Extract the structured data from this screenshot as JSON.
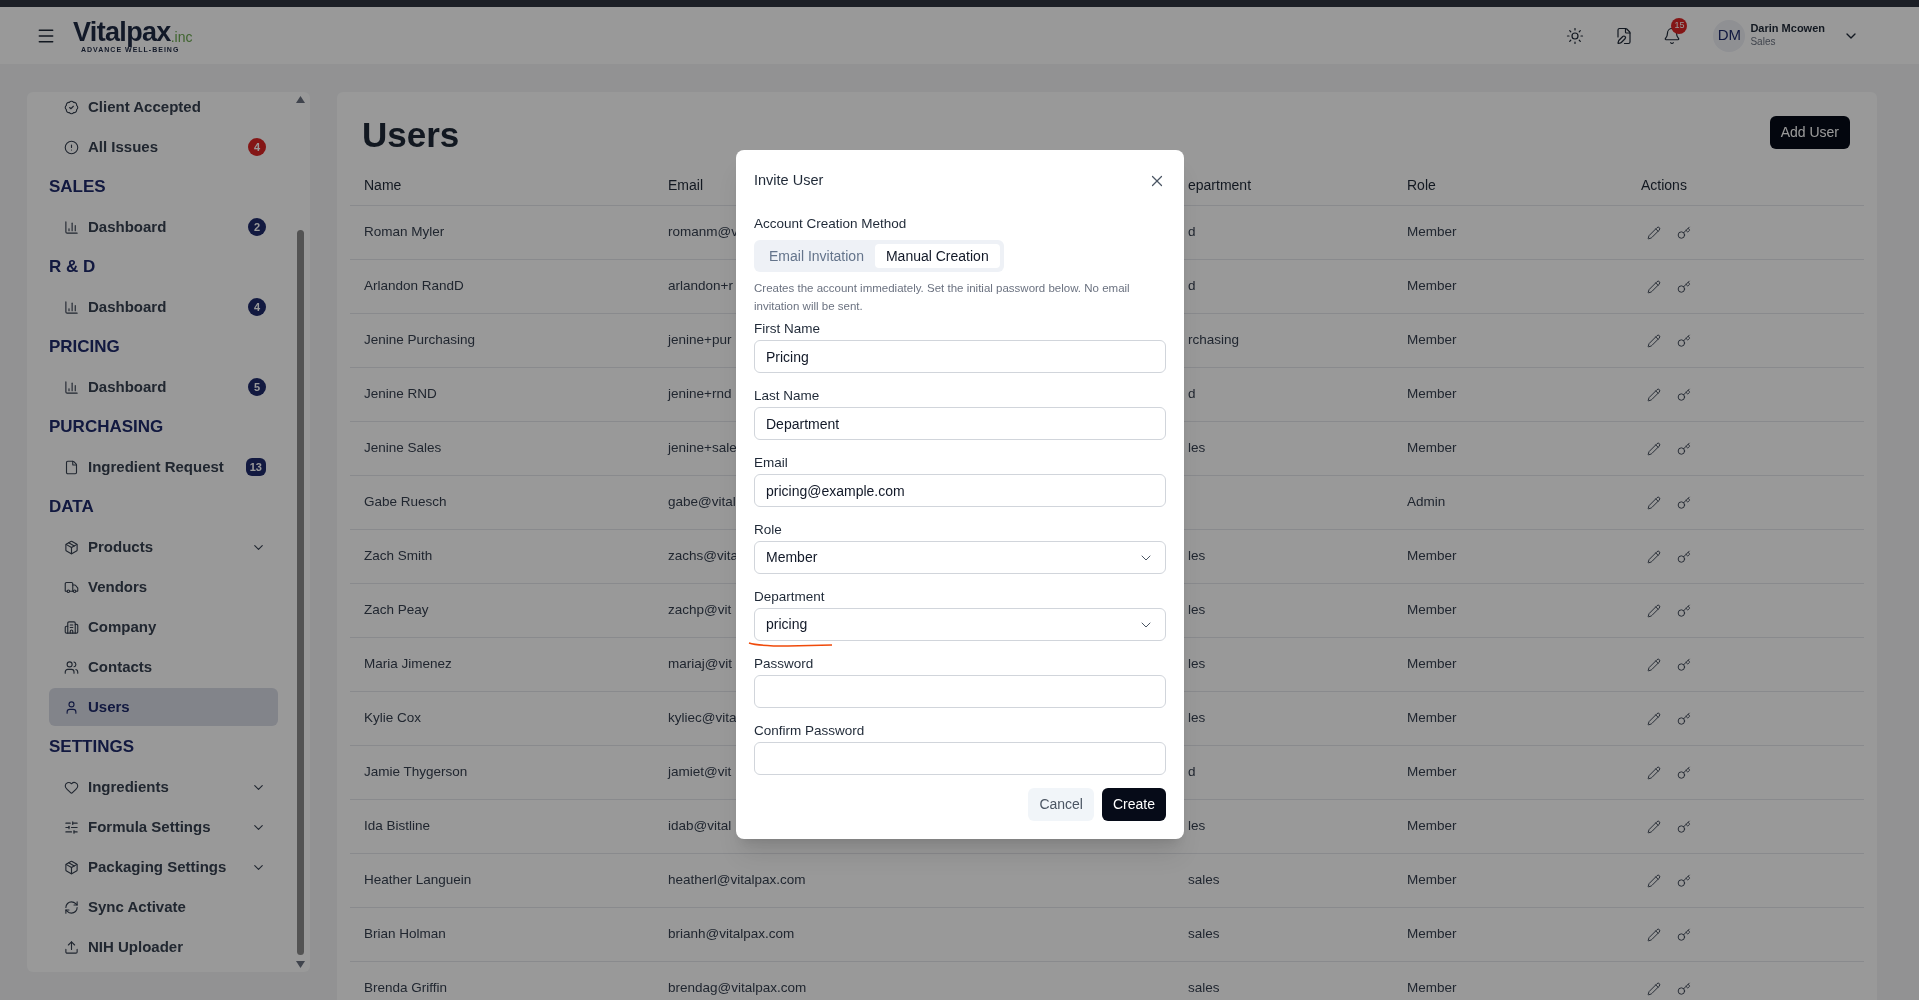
{
  "header": {
    "logo": {
      "name": "Vitalpax",
      "suffix": ".inc",
      "tagline": "ADVANCE WELL-BEING"
    },
    "notification_count": "15",
    "user": {
      "initials": "DM",
      "name": "Darin Mcowen",
      "role": "Sales"
    }
  },
  "sidebar": {
    "items": [
      {
        "kind": "item",
        "label": "Client Accepted",
        "expandable": false,
        "selected": false
      },
      {
        "kind": "item",
        "label": "All Issues",
        "badge": "4",
        "color": "#841717",
        "expandable": false,
        "selected": false
      },
      {
        "kind": "heading",
        "label": "SALES"
      },
      {
        "kind": "item",
        "label": "Dashboard",
        "badge": "2",
        "color": "#121940",
        "expandable": false,
        "selected": false
      },
      {
        "kind": "heading",
        "label": "R & D"
      },
      {
        "kind": "item",
        "label": "Dashboard",
        "badge": "4",
        "color": "#121940",
        "expandable": false,
        "selected": false
      },
      {
        "kind": "heading",
        "label": "PRICING"
      },
      {
        "kind": "item",
        "label": "Dashboard",
        "badge": "5",
        "color": "#121940",
        "expandable": false,
        "selected": false
      },
      {
        "kind": "heading",
        "label": "PURCHASING"
      },
      {
        "kind": "item",
        "label": "Ingredient Request",
        "badge": "13",
        "color": "#121940",
        "expandable": false,
        "selected": false
      },
      {
        "kind": "heading",
        "label": "DATA"
      },
      {
        "kind": "item",
        "label": "Products",
        "expandable": true,
        "selected": false
      },
      {
        "kind": "item",
        "label": "Vendors",
        "expandable": false,
        "selected": false
      },
      {
        "kind": "item",
        "label": "Company",
        "expandable": false,
        "selected": false
      },
      {
        "kind": "item",
        "label": "Contacts",
        "expandable": false,
        "selected": false
      },
      {
        "kind": "item",
        "label": "Users",
        "expandable": false,
        "selected": true
      },
      {
        "kind": "heading",
        "label": "SETTINGS"
      },
      {
        "kind": "item",
        "label": "Ingredients",
        "expandable": true,
        "selected": false
      },
      {
        "kind": "item",
        "label": "Formula Settings",
        "expandable": true,
        "selected": false
      },
      {
        "kind": "item",
        "label": "Packaging Settings",
        "expandable": true,
        "selected": false
      },
      {
        "kind": "item",
        "label": "Sync Activate",
        "expandable": false,
        "selected": false
      },
      {
        "kind": "item",
        "label": "NIH Uploader",
        "expandable": false,
        "selected": false
      }
    ]
  },
  "page": {
    "title": "Users",
    "add_button": "Add User"
  },
  "table": {
    "columns": [
      "Name",
      "Email",
      "epartment",
      "Role",
      "Actions"
    ],
    "rows": [
      {
        "name": "Roman Myler",
        "email": "romanm@v",
        "department": "d",
        "role": "Member"
      },
      {
        "name": "Arlandon RandD",
        "email": "arlandon+r",
        "department": "d",
        "role": "Member"
      },
      {
        "name": "Jenine Purchasing",
        "email": "jenine+pur",
        "department": "rchasing",
        "role": "Member"
      },
      {
        "name": "Jenine RND",
        "email": "jenine+rnd",
        "department": "d",
        "role": "Member"
      },
      {
        "name": "Jenine Sales",
        "email": "jenine+sale",
        "department": "les",
        "role": "Member"
      },
      {
        "name": "Gabe Ruesch",
        "email": "gabe@vital",
        "role": "Admin"
      },
      {
        "name": "Zach Smith",
        "email": "zachs@vita",
        "department": "les",
        "role": "Member"
      },
      {
        "name": "Zach Peay",
        "email": "zachp@vit",
        "department": "les",
        "role": "Member"
      },
      {
        "name": "Maria Jimenez",
        "email": "mariaj@vit",
        "department": "les",
        "role": "Member"
      },
      {
        "name": "Kylie Cox",
        "email": "kyliec@vita",
        "department": "les",
        "role": "Member"
      },
      {
        "name": "Jamie Thygerson",
        "email": "jamiet@vit",
        "department": "d",
        "role": "Member"
      },
      {
        "name": "Ida Bistline",
        "email": "idab@vital",
        "department": "les",
        "role": "Member"
      },
      {
        "name": "Heather Languein",
        "email": "heatherl@vitalpax.com",
        "department": "sales",
        "role": "Member"
      },
      {
        "name": "Brian Holman",
        "email": "brianh@vitalpax.com",
        "department": "sales",
        "role": "Member"
      },
      {
        "name": "Brenda Griffin",
        "email": "brendag@vitalpax.com",
        "department": "sales",
        "role": "Member"
      }
    ]
  },
  "modal": {
    "title": "Invite User",
    "method_label": "Account Creation Method",
    "tabs": [
      {
        "label": "Email Invitation",
        "selected": false
      },
      {
        "label": "Manual Creation",
        "selected": true
      }
    ],
    "hint": "Creates the account immediately. Set the initial password below. No email invitation will be sent.",
    "fields": [
      {
        "kind": "text",
        "label": "First Name",
        "value": "Pricing"
      },
      {
        "kind": "text",
        "label": "Last Name",
        "value": "Department"
      },
      {
        "kind": "text",
        "label": "Email",
        "value": "pricing@example.com"
      },
      {
        "kind": "select",
        "label": "Role",
        "value": "Member"
      },
      {
        "kind": "select",
        "label": "Department",
        "value": "pricing",
        "underlined": true
      },
      {
        "kind": "password",
        "label": "Password"
      },
      {
        "kind": "password",
        "label": "Confirm Password"
      }
    ],
    "cancel": "Cancel",
    "submit": "Create"
  }
}
